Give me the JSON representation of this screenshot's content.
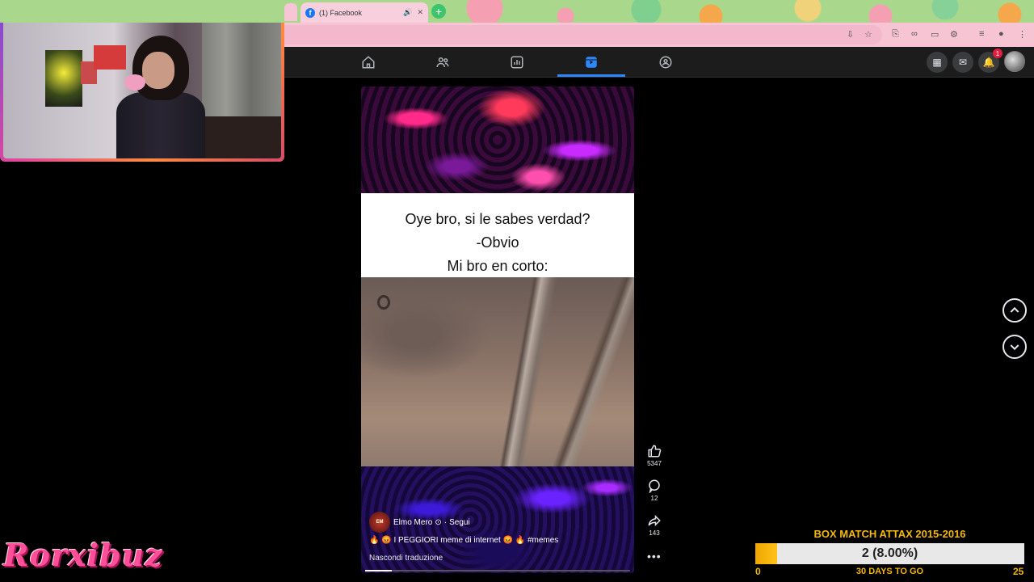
{
  "browser": {
    "tab_title": "(1) Facebook",
    "new_tab_label": "+",
    "tab_close_label": "✕"
  },
  "facebook": {
    "nav": [
      "home-icon",
      "friends-icon",
      "dashboard-icon",
      "reels-icon",
      "groups-icon"
    ],
    "notification_count": "1"
  },
  "reel": {
    "caption_lines": [
      "Oye bro, si le sabes verdad?",
      "-Obvio",
      "Mi bro en corto:"
    ],
    "author_name": "Elmo Mero",
    "author_verified": "⊙",
    "separator": "·",
    "follow_label": "Segui",
    "description": "🔥 😡 I PEGGIORI meme di internet 😡 🔥 #memes",
    "translate_label": "Nascondi traduzione",
    "likes": "5347",
    "comments": "12",
    "shares": "143",
    "more_label": "•••",
    "progress": 0.1
  },
  "overlay": {
    "streamer_logo": "Rorxibuz",
    "goal_title": "BOX MATCH ATTAX 2015-2016",
    "goal_value_text": "2 (8.00%)",
    "goal_fraction": 0.08,
    "goal_min": "0",
    "goal_max": "25",
    "goal_days": "30 DAYS TO GO"
  },
  "colors": {
    "accent": "#2d88ff",
    "goal": "#f5b800",
    "logo": "#ff4f98"
  }
}
